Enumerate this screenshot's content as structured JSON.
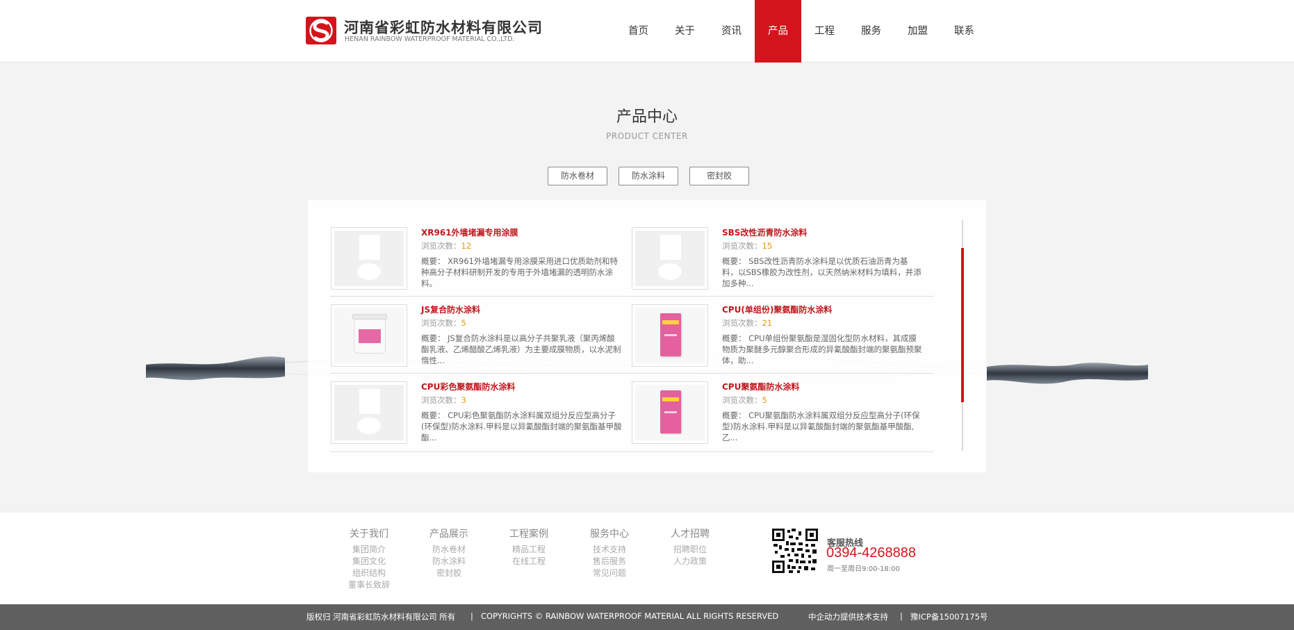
{
  "header": {
    "brand_cn": "河南省彩虹防水材料有限公司",
    "brand_en": "HENAN RAINBOW WATERPROOF MATERIAL CO.,LTD.",
    "nav": [
      {
        "label": "首页",
        "active": false
      },
      {
        "label": "关于",
        "active": false
      },
      {
        "label": "资讯",
        "active": false
      },
      {
        "label": "产品",
        "active": true
      },
      {
        "label": "工程",
        "active": false
      },
      {
        "label": "服务",
        "active": false
      },
      {
        "label": "加盟",
        "active": false
      },
      {
        "label": "联系",
        "active": false
      }
    ]
  },
  "section": {
    "title": "产品中心",
    "subtitle": "PRODUCT CENTER"
  },
  "categories": [
    "防水卷材",
    "防水涂料",
    "密封胶"
  ],
  "products": [
    {
      "title": "XR961外墙堵漏专用涂膜",
      "views_label": "浏览次数：",
      "views": "12",
      "desc": "概要： XR961外墙堵漏专用涂膜采用进口优质助剂和特种高分子材料研制开发的专用于外墙堵漏的透明防水涂料。",
      "image": "placeholder"
    },
    {
      "title": "SBS改性沥青防水涂料",
      "views_label": "浏览次数：",
      "views": "15",
      "desc": "概要： SBS改性沥青防水涂料是以优质石油沥青为基料，以SBS橡胶为改性剂，以天然纳米材料为填料，并添加多种...",
      "image": "placeholder"
    },
    {
      "title": "JS复合防水涂料",
      "views_label": "浏览次数：",
      "views": "5",
      "desc": "概要： JS复合防水涂料是以高分子共聚乳液（聚丙烯酸酯乳液、乙烯醋酸乙烯乳液）为主要成膜物质，以水泥制惰性...",
      "image": "bucket"
    },
    {
      "title": "CPU(单组份)聚氨酯防水涂料",
      "views_label": "浏览次数：",
      "views": "21",
      "desc": "概要： CPU单组份聚氨酯是湿固化型防水材料，其成膜物质为聚醚多元醇聚合形成的异氰酸酯封端的聚氨酯预聚体，助...",
      "image": "bag"
    },
    {
      "title": "CPU彩色聚氨酯防水涂料",
      "views_label": "浏览次数：",
      "views": "3",
      "desc": "概要： CPU彩色聚氨酯防水涂料属双组分反应型高分子(环保型)防水涂料.甲料是以异氰酸酯封端的聚氨酯基甲酸酯...",
      "image": "placeholder"
    },
    {
      "title": "CPU聚氨酯防水涂料",
      "views_label": "浏览次数：",
      "views": "5",
      "desc": "概要： CPU聚氨酯防水涂料属双组分反应型高分子(环保型)防水涂料.甲料是以异氰酸酯封端的聚氨酯基甲酸酯,乙...",
      "image": "bag"
    }
  ],
  "footer": {
    "columns": [
      {
        "heading": "关于我们",
        "links": [
          "集团简介",
          "集团文化",
          "组织结构",
          "董事长致辞"
        ]
      },
      {
        "heading": "产品展示",
        "links": [
          "防水卷材",
          "防水涂料",
          "密封胶"
        ]
      },
      {
        "heading": "工程案例",
        "links": [
          "精品工程",
          "在线工程"
        ]
      },
      {
        "heading": "服务中心",
        "links": [
          "技术支持",
          "售后服务",
          "常见问题"
        ]
      },
      {
        "heading": "人才招聘",
        "links": [
          "招聘职位",
          "人力政策"
        ]
      }
    ],
    "hotline_label": "客服热线",
    "hotline_number": "0394-4268888",
    "hotline_time": "周一至周日9:00-18:00"
  },
  "copyright": {
    "owner": "版权归 河南省彩虹防水材料有限公司 所有",
    "sep": "|",
    "rights": "COPYRIGHTS © RAINBOW WATERPROOF MATERIAL ALL RIGHTS RESERVED",
    "support": "中企动力提供技术支持",
    "icp": "豫ICP备15007175号"
  },
  "colors": {
    "accent": "#d4141c",
    "title_red": "#c0181f",
    "views_num": "#e29a10",
    "footer_bar": "#5f5f5f"
  },
  "icons": [
    "logo-s-icon",
    "qr-code-icon"
  ]
}
